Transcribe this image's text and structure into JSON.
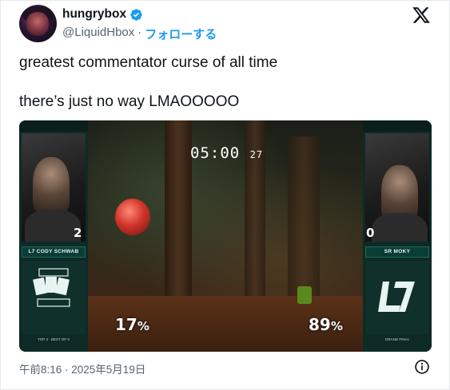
{
  "author": {
    "display_name": "hungrybox",
    "handle": "@LiquidHbox",
    "separator": "·",
    "follow_label": "フォローする",
    "verified_color": "#1d9bf0"
  },
  "tweet": {
    "line1": "greatest commentator curse of all time",
    "line2": "there’s just no way LMAOOOOO"
  },
  "media": {
    "timer_main": "05:00",
    "timer_ms": "27",
    "left_player": {
      "score": "2",
      "name": "L7 CODY SCHWAB",
      "percent": "17",
      "sub": "TOP 4 · BEST OF 5"
    },
    "right_player": {
      "score": "0",
      "name": "SR MOKY",
      "percent": "89",
      "sub": "GRAND FINAL"
    },
    "percent_symbol": "%",
    "accent_color": "#0e2a26"
  },
  "footer": {
    "timestamp": "午前8:16 · 2025年5月19日"
  }
}
